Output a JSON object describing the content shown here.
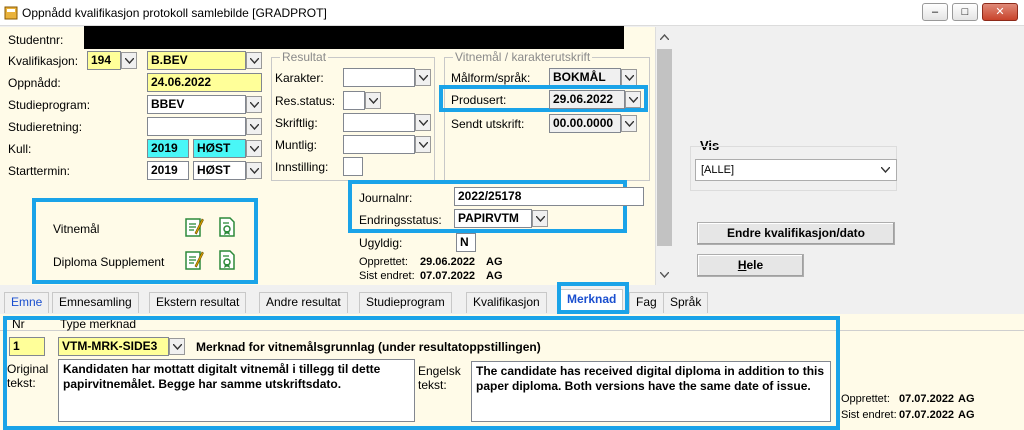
{
  "window": {
    "title": "Oppnådd kvalifikasjon protokoll samlebilde [GRADPROT]",
    "minimize": "–",
    "maximize": "□",
    "close": "✕"
  },
  "form": {
    "studentnr_label": "Studentnr:",
    "kvalifikasjon_label": "Kvalifikasjon:",
    "kvalifikasjon_code": "194",
    "kvalifikasjon_value": "B.BEV",
    "oppnadd_label": "Oppnådd:",
    "oppnadd_value": "24.06.2022",
    "studieprogram_label": "Studieprogram:",
    "studieprogram_value": "BBEV",
    "studieretning_label": "Studieretning:",
    "studieretning_value": "",
    "kull_label": "Kull:",
    "kull_year": "2019",
    "kull_term": "HØST",
    "starttermin_label": "Starttermin:",
    "starttermin_year": "2019",
    "starttermin_term": "HØST",
    "resultat": {
      "legend": "Resultat",
      "karakter_label": "Karakter:",
      "resstatus_label": "Res.status:",
      "skriftlig_label": "Skriftlig:",
      "muntlig_label": "Muntlig:",
      "innstilling_label": "Innstilling:"
    },
    "vitnemal": {
      "legend": "Vitnemål / karakterutskrift",
      "malform_label": "Målform/språk:",
      "malform_value": "BOKMÅL",
      "produsert_label": "Produsert:",
      "produsert_value": "29.06.2022",
      "sendt_label": "Sendt utskrift:",
      "sendt_value": "00.00.0000"
    },
    "documents": {
      "vitnemal_label": "Vitnemål",
      "diploma_label": "Diploma Supplement"
    },
    "journalnr_label": "Journalnr:",
    "journalnr_value": "2022/25178",
    "endringsstatus_label": "Endringsstatus:",
    "endringsstatus_value": "PAPIRVTM",
    "ugyldig_label": "Ugyldig:",
    "ugyldig_value": "N",
    "opprettet_label": "Opprettet:",
    "opprettet_date": "29.06.2022",
    "opprettet_user": "AG",
    "sist_endret_label": "Sist endret:",
    "sist_endret_date": "07.07.2022",
    "sist_endret_user": "AG"
  },
  "right": {
    "vis_label": "Vis",
    "vis_value": "[ALLE]",
    "endre_button": "Endre kvalifikasjon/dato",
    "hele_button": "Hele",
    "hele_mnemonic": "H",
    "hele_rest": "ele"
  },
  "tabs": [
    {
      "label": "Emne",
      "active": false
    },
    {
      "label": "Emnesamling",
      "active": false
    },
    {
      "label": "Ekstern resultat",
      "active": false
    },
    {
      "label": "Andre resultat",
      "active": false
    },
    {
      "label": "Studieprogram",
      "active": false
    },
    {
      "label": "Kvalifikasjon",
      "active": false
    },
    {
      "label": "Merknad",
      "active": true
    },
    {
      "label": "Fag",
      "active": false
    },
    {
      "label": "Språk",
      "active": false
    }
  ],
  "merknad": {
    "nr_header": "Nr",
    "type_header": "Type merknad",
    "nr_value": "1",
    "type_value": "VTM-MRK-SIDE3",
    "type_description": "Merknad for vitnemålsgrunnlag (under resultatoppstillingen)",
    "original_label_1": "Original",
    "original_label_2": "tekst:",
    "original_text": "Kandidaten har mottatt digitalt vitnemål i tillegg til dette papirvitnemålet. Begge har samme utskriftsdato.",
    "engelsk_label_1": "Engelsk",
    "engelsk_label_2": "tekst:",
    "engelsk_text": "The candidate has received digital diploma in addition to this paper diploma. Both versions have the same date of issue.",
    "opprettet_label": "Opprettet:",
    "opprettet_date": "07.07.2022",
    "opprettet_user": "AG",
    "sist_endret_label": "Sist endret:",
    "sist_endret_date": "07.07.2022",
    "sist_endret_user": "AG"
  },
  "colors": {
    "highlight": "#1aa3e8",
    "form_bg": "#fffbe8",
    "yellow_field": "#ffff99",
    "cyan_field": "#49f7f7",
    "active_tab": "#1a4fcf"
  }
}
